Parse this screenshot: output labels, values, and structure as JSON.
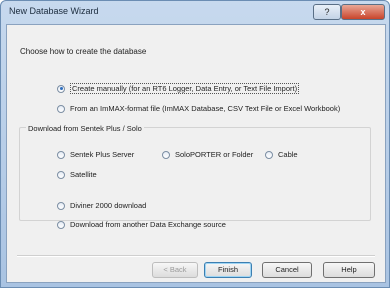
{
  "window": {
    "title": "New Database Wizard",
    "help_glyph": "?",
    "close_glyph": "x"
  },
  "heading": "Choose how to create the database",
  "options": {
    "manual": "Create manually (for an RT6 Logger, Data Entry, or Text File Import)",
    "immax": "From an ImMAX-format file (ImMAX Database, CSV Text File or Excel Workbook)"
  },
  "download_group": {
    "label": "Download from Sentek Plus / Solo",
    "items": {
      "sentek_server": "Sentek Plus Server",
      "soloporter": "SoloPORTER or Folder",
      "cable": "Cable",
      "satellite": "Satellite"
    }
  },
  "more_options": {
    "diviner": "Diviner 2000 download",
    "data_exchange": "Download from another Data Exchange source"
  },
  "buttons": {
    "back": "< Back",
    "finish": "Finish",
    "cancel": "Cancel",
    "help": "Help"
  },
  "selected_option": "manual"
}
